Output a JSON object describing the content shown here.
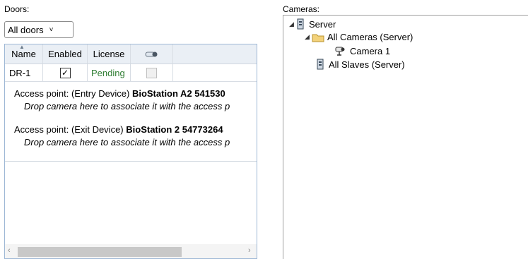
{
  "doors": {
    "label": "Doors:",
    "filter": {
      "selected": "All doors",
      "caret": "˅"
    },
    "columns": {
      "name": "Name",
      "enabled": "Enabled",
      "license": "License"
    },
    "rows": [
      {
        "name": "DR-1",
        "enabled_mark": "✓",
        "license": "Pending"
      }
    ],
    "access_points": [
      {
        "prefix": "Access point:",
        "device_type": "(Entry Device)",
        "device_name": "BioStation A2 541530",
        "drop_hint": "Drop camera here to associate it with the access p"
      },
      {
        "prefix": "Access point:",
        "device_type": "(Exit Device)",
        "device_name": "BioStation 2 54773264",
        "drop_hint": "Drop camera here to associate it with the access p"
      }
    ],
    "scroll": {
      "left": "‹",
      "right": "›"
    }
  },
  "cameras": {
    "label": "Cameras:",
    "tree": {
      "server": "Server",
      "all_cameras": "All Cameras (Server)",
      "camera_1": "Camera 1",
      "all_slaves": "All Slaves (Server)"
    }
  },
  "colors": {
    "pending": "#2e7d32",
    "panel_border": "#9db7d5",
    "header_bg": "#eaeff5"
  }
}
